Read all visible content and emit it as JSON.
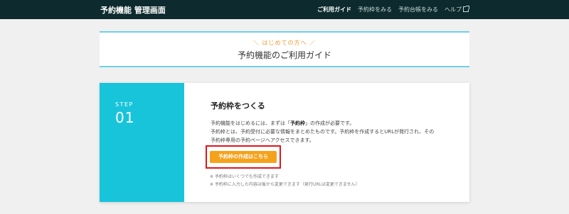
{
  "header": {
    "brand": "予約機能 管理画面",
    "nav": [
      {
        "label": "ご利用ガイド"
      },
      {
        "label": "予約枠をみる"
      },
      {
        "label": "予約台帳をみる"
      },
      {
        "label": "ヘルプ"
      }
    ]
  },
  "guide": {
    "subtitle": "＼ はじめての方へ ／",
    "title": "予約機能のご利用ガイド"
  },
  "step": {
    "label": "STEP",
    "number": "01",
    "title": "予約枠をつくる",
    "desc_line1_pre": "予約機能をはじめるには、まずは「",
    "desc_line1_bold": "予約枠",
    "desc_line1_post": "」の作成が必要です。",
    "desc_line2": "予約枠とは、予約受付に必要な情報をまとめたものです。予約枠を作成するとURLが発行され、その",
    "desc_line3": "予約枠専用の予約ページへアクセスできます。",
    "cta_label": "予約枠の作成はこちら",
    "note1": "※ 予約枠はいくつでも作成できます",
    "note2": "※ 予約枠に入力した内容は後から変更できます（発行URLは変更できません）"
  },
  "colors": {
    "header_bg": "#0d2b2e",
    "accent_cyan": "#18c4da",
    "band_line": "#6fd0e6",
    "cta_orange": "#f5a21b",
    "subtitle_orange": "#f29a2e",
    "highlight_red": "#e3141b"
  },
  "icons": {
    "help_external": "external-link-icon"
  }
}
